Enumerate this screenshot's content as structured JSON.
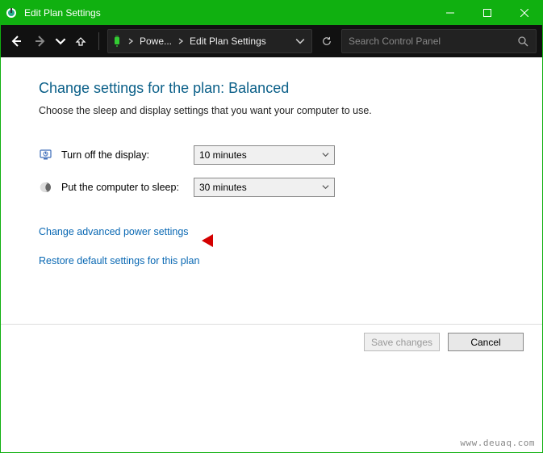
{
  "window": {
    "title": "Edit Plan Settings"
  },
  "breadcrumb": {
    "seg1": "Powe...",
    "seg2": "Edit Plan Settings"
  },
  "search": {
    "placeholder": "Search Control Panel"
  },
  "page": {
    "heading": "Change settings for the plan: Balanced",
    "subtext": "Choose the sleep and display settings that you want your computer to use."
  },
  "settings": {
    "display_label": "Turn off the display:",
    "display_value": "10 minutes",
    "sleep_label": "Put the computer to sleep:",
    "sleep_value": "30 minutes"
  },
  "links": {
    "advanced": "Change advanced power settings",
    "restore": "Restore default settings for this plan"
  },
  "buttons": {
    "save": "Save changes",
    "cancel": "Cancel"
  },
  "watermark": "www.deuaq.com"
}
